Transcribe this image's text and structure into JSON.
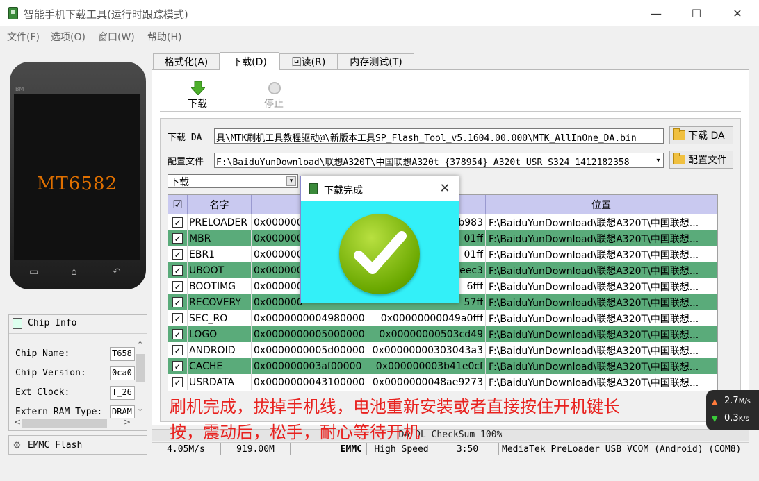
{
  "window": {
    "title": "智能手机下载工具(运行时跟踪模式)",
    "minimize": "—",
    "maximize": "☐",
    "close": "✕"
  },
  "menu": [
    "文件(F)",
    "选项(O)",
    "窗口(W)",
    "帮助(H)"
  ],
  "phone": {
    "brand": "BM",
    "chip": "MT6582",
    "keys": [
      "▭",
      "⌂",
      "↶"
    ]
  },
  "chip_info": {
    "title": "Chip Info",
    "fields": [
      {
        "label": "Chip Name:",
        "value": "T658"
      },
      {
        "label": "Chip Version:",
        "value": "0ca0"
      },
      {
        "label": "Ext Clock:",
        "value": "T_26"
      },
      {
        "label": "Extern RAM Type:",
        "value": "DRAM"
      }
    ],
    "scroll_up": "⌃",
    "scroll_down": "⌄",
    "scroll_left": "<",
    "scroll_right": ">"
  },
  "emmc_panel": {
    "label": "EMMC Flash"
  },
  "tabs": [
    "格式化(A)",
    "下载(D)",
    "回读(R)",
    "内存测试(T)"
  ],
  "toolbar": {
    "download_label": "下载",
    "stop_label": "停止"
  },
  "da": {
    "label": "下载 DA",
    "path": "具\\MTK刷机工具教程驱动@\\新版本工具SP_Flash_Tool_v5.1604.00.000\\MTK_AllInOne_DA.bin",
    "button": "下载 DA"
  },
  "scatter": {
    "label": "配置文件",
    "path": "F:\\BaiduYunDownload\\联想A320T\\中国联想A320t_{378954}_A320t_USR_S324_1412182358_",
    "button": "配置文件",
    "arrow": "▾"
  },
  "mode": {
    "selected": "下载",
    "arrow": "▾"
  },
  "table": {
    "headers": {
      "check": "☑",
      "name": "名字",
      "begin": "开",
      "end": "",
      "location": "位置"
    },
    "rows": [
      {
        "name": "PRELOADER",
        "begin": "0x000000",
        "end": "b983",
        "loc": "F:\\BaiduYunDownload\\联想A320T\\中国联想..."
      },
      {
        "name": "MBR",
        "begin": "0x000000",
        "end": "01ff",
        "loc": "F:\\BaiduYunDownload\\联想A320T\\中国联想..."
      },
      {
        "name": "EBR1",
        "begin": "0x000000",
        "end": "01ff",
        "loc": "F:\\BaiduYunDownload\\联想A320T\\中国联想..."
      },
      {
        "name": "UBOOT",
        "begin": "0x000000",
        "end": "eec3",
        "loc": "F:\\BaiduYunDownload\\联想A320T\\中国联想..."
      },
      {
        "name": "BOOTIMG",
        "begin": "0x000000",
        "end": "6fff",
        "loc": "F:\\BaiduYunDownload\\联想A320T\\中国联想..."
      },
      {
        "name": "RECOVERY",
        "begin": "0x000000",
        "end": "57ff",
        "loc": "F:\\BaiduYunDownload\\联想A320T\\中国联想..."
      },
      {
        "name": "SEC_RO",
        "begin": "0x0000000004980000",
        "end": "0x00000000049a0fff",
        "loc": "F:\\BaiduYunDownload\\联想A320T\\中国联想..."
      },
      {
        "name": "LOGO",
        "begin": "0x0000000005000000",
        "end": "0x00000000503cd49",
        "loc": "F:\\BaiduYunDownload\\联想A320T\\中国联想..."
      },
      {
        "name": "ANDROID",
        "begin": "0x0000000005d00000",
        "end": "0x00000000303043a3",
        "loc": "F:\\BaiduYunDownload\\联想A320T\\中国联想..."
      },
      {
        "name": "CACHE",
        "begin": "0x000000003af00000",
        "end": "0x000000003b41e0cf",
        "loc": "F:\\BaiduYunDownload\\联想A320T\\中国联想..."
      },
      {
        "name": "USRDATA",
        "begin": "0x0000000043100000",
        "end": "0x0000000048ae9273",
        "loc": "F:\\BaiduYunDownload\\联想A320T\\中国联想..."
      }
    ]
  },
  "dialog": {
    "title": "下载完成",
    "close": "✕",
    "check": "✓"
  },
  "overlay_text": [
    "刷机完成，拔掉手机线，电池重新安装或者直接按住开机键长",
    "按，震动后，松手，耐心等待开机"
  ],
  "checksum": "DA DL CheckSum 100%",
  "status": {
    "speed": "4.05M/s",
    "size": "919.00M",
    "storage": "EMMC",
    "usb_speed": "High Speed",
    "time": "3:50",
    "port": "MediaTek PreLoader USB VCOM (Android) (COM8)"
  },
  "net_speed": {
    "up": "2.7",
    "up_unit": "M/s",
    "down": "0.3",
    "down_unit": "K/s",
    "up_arrow": "▲",
    "down_arrow": "▼"
  },
  "colors": {
    "row_highlight": "#5aab7a",
    "header": "#c9c9f0",
    "dialog_body": "#33f0f8",
    "overlay_text": "#e8221f",
    "chip_text": "#e07000"
  }
}
